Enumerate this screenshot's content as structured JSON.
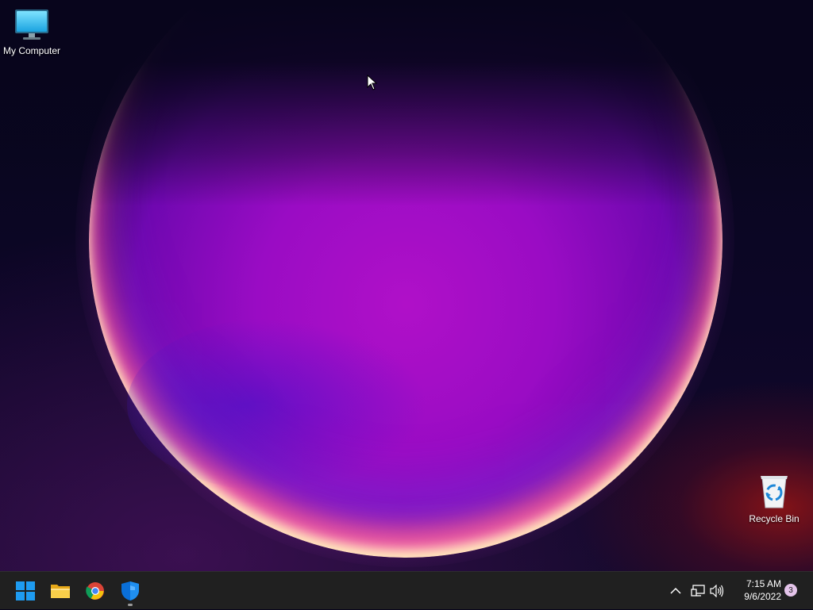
{
  "desktop": {
    "icons": [
      {
        "label": "My Computer",
        "icon": "monitor-icon"
      },
      {
        "label": "Recycle Bin",
        "icon": "recycle-bin-icon"
      }
    ]
  },
  "taskbar": {
    "pinned": [
      {
        "name": "Start",
        "icon": "windows-logo-icon"
      },
      {
        "name": "File Explorer",
        "icon": "folder-icon"
      },
      {
        "name": "Google Chrome",
        "icon": "chrome-icon"
      },
      {
        "name": "Windows Security",
        "icon": "shield-icon",
        "active": true
      }
    ],
    "tray": {
      "chevron_icon": "chevron-up-icon",
      "network_icon": "network-icon",
      "volume_icon": "volume-icon",
      "time": "7:15 AM",
      "date": "9/6/2022",
      "notification_count": "3"
    }
  },
  "colors": {
    "taskbar": "#202020",
    "accent_blue": "#0a84ff",
    "folder_yellow": "#f5c542",
    "notification_badge": "#e4c4ea"
  }
}
